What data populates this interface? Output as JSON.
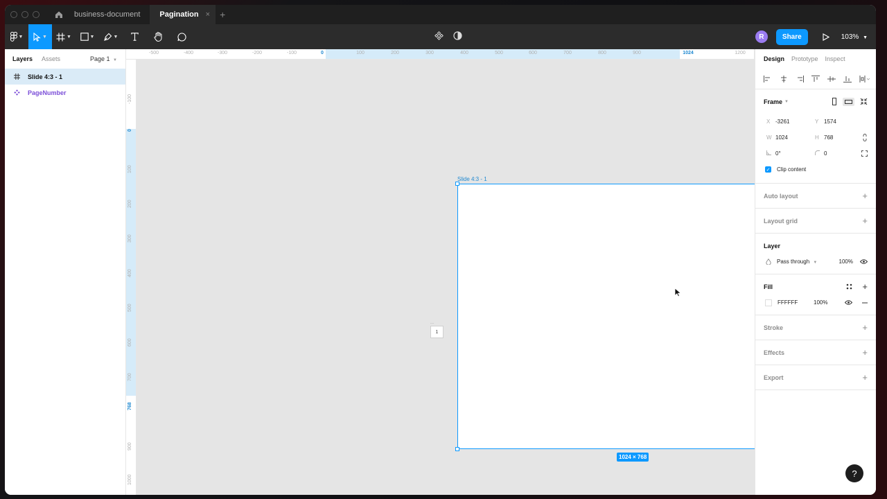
{
  "titlebar": {
    "tabs": [
      {
        "label": "business-document",
        "active": false
      },
      {
        "label": "Pagination",
        "active": true
      }
    ],
    "close_glyph": "×",
    "add_glyph": "+"
  },
  "toolbar": {
    "avatar_initial": "R",
    "share_label": "Share",
    "zoom_label": "103%"
  },
  "left_panel": {
    "tabs": [
      {
        "label": "Layers",
        "active": true
      },
      {
        "label": "Assets",
        "active": false
      }
    ],
    "page_label": "Page 1",
    "layers": [
      {
        "label": "Slide 4:3 - 1",
        "icon": "frame-icon",
        "selected": true
      },
      {
        "label": "PageNumber",
        "icon": "component-icon",
        "selected": false
      }
    ]
  },
  "rulers": {
    "top_ticks": [
      "-500",
      "-400",
      "-300",
      "-200",
      "-100",
      "0",
      "100",
      "200",
      "300",
      "400",
      "500",
      "600",
      "700",
      "800",
      "900",
      "1024",
      "1200"
    ],
    "left_ticks": [
      "-100",
      "0",
      "100",
      "200",
      "300",
      "400",
      "500",
      "600",
      "700",
      "768",
      "900",
      "1000"
    ]
  },
  "canvas": {
    "frame_label": "Slide 4:3 - 1",
    "size_badge": "1024 × 768",
    "mini_frame_label": "...",
    "mini_frame_text": "1"
  },
  "right_panel": {
    "tabs": [
      {
        "label": "Design",
        "active": true
      },
      {
        "label": "Prototype",
        "active": false
      },
      {
        "label": "Inspect",
        "active": false
      }
    ],
    "frame": {
      "title": "Frame",
      "x_label": "X",
      "x": "-3261",
      "y_label": "Y",
      "y": "1574",
      "w_label": "W",
      "w": "1024",
      "h_label": "H",
      "h": "768",
      "rotation": "0°",
      "radius": "0",
      "clip_content": "Clip content"
    },
    "auto_layout": "Auto layout",
    "layout_grid": "Layout grid",
    "layer": {
      "title": "Layer",
      "blend": "Pass through",
      "opacity": "100%"
    },
    "fill": {
      "title": "Fill",
      "hex": "FFFFFF",
      "opacity": "100%"
    },
    "stroke": "Stroke",
    "effects": "Effects",
    "export": "Export"
  },
  "help_label": "?",
  "colors": {
    "accent": "#0d99ff",
    "component": "#7b4ed8",
    "canvas": "#e5e5e5"
  }
}
